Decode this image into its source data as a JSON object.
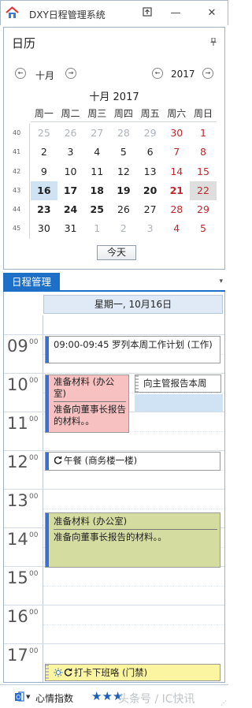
{
  "window": {
    "title": "DXY日程管理系统",
    "pin_label": "⊼",
    "minimize_label": "—",
    "close_label": "✕"
  },
  "calendar_panel": {
    "header": "日历",
    "month_nav_label": "十月",
    "year_nav_label": "2017",
    "month_title": "十月 2017",
    "weekdays": [
      "周一",
      "周二",
      "周三",
      "周四",
      "周五",
      "周六",
      "周日"
    ],
    "week_numbers": [
      "40",
      "41",
      "42",
      "43",
      "44",
      "45"
    ],
    "weeks": [
      [
        "25",
        "26",
        "27",
        "28",
        "29",
        "30",
        "1"
      ],
      [
        "2",
        "3",
        "4",
        "5",
        "6",
        "7",
        "8"
      ],
      [
        "9",
        "10",
        "11",
        "12",
        "13",
        "14",
        "15"
      ],
      [
        "16",
        "17",
        "18",
        "19",
        "20",
        "21",
        "22"
      ],
      [
        "23",
        "24",
        "25",
        "26",
        "27",
        "28",
        "29"
      ],
      [
        "30",
        "31",
        "1",
        "2",
        "3",
        "4",
        "5"
      ]
    ],
    "today_button": "今天"
  },
  "schedule_panel": {
    "tab_label": "日程管理",
    "dropdown_label": "▾",
    "date_header": "星期一, 10月16日",
    "hours": [
      "09",
      "10",
      "11",
      "12",
      "13",
      "14",
      "15",
      "16",
      "17"
    ],
    "minutes_label": "00",
    "events": {
      "plan": {
        "title": "09:00-09:45 罗列本周工作计划 (工作)"
      },
      "materials_1": {
        "title": "准备材料 (办公室)",
        "note": "准备向董事长报告的材料。。"
      },
      "report": {
        "title": "向主管报告本周"
      },
      "lunch": {
        "title": "午餐 (商务楼一楼)"
      },
      "materials_2": {
        "title": "准备材料 (办公室)",
        "note": "准备向董事长报告的材料。。"
      },
      "clockout": {
        "title": "打卡下班咯 (门禁)"
      }
    },
    "colors": {
      "accent": "#1e6fc8",
      "event_red": "#f7c1c1",
      "event_green": "#d4dca0",
      "event_yellow": "#fbf4a0",
      "today_highlight": "#cfe3f5"
    }
  },
  "statusbar": {
    "mood_label": "心情指数",
    "stars": "★★★",
    "watermark": "头条号 / IC快讯"
  }
}
